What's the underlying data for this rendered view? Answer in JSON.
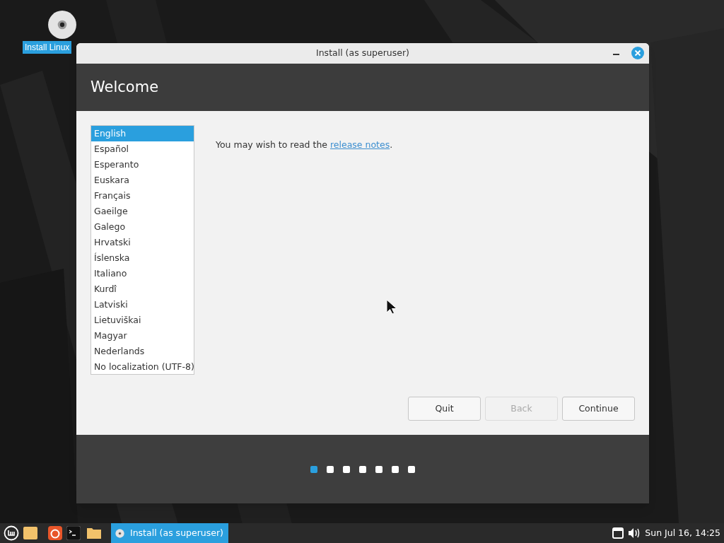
{
  "desktop": {
    "icons": [
      {
        "label": "Install Linux",
        "selected": true
      }
    ]
  },
  "window": {
    "title": "Install (as superuser)",
    "header": "Welcome",
    "languages": [
      {
        "label": "English",
        "selected": true
      },
      {
        "label": "Español",
        "selected": false
      },
      {
        "label": "Esperanto",
        "selected": false
      },
      {
        "label": "Euskara",
        "selected": false
      },
      {
        "label": "Français",
        "selected": false
      },
      {
        "label": "Gaeilge",
        "selected": false
      },
      {
        "label": "Galego",
        "selected": false
      },
      {
        "label": "Hrvatski",
        "selected": false
      },
      {
        "label": "Íslenska",
        "selected": false
      },
      {
        "label": "Italiano",
        "selected": false
      },
      {
        "label": "Kurdî",
        "selected": false
      },
      {
        "label": "Latviski",
        "selected": false
      },
      {
        "label": "Lietuviškai",
        "selected": false
      },
      {
        "label": "Magyar",
        "selected": false
      },
      {
        "label": "Nederlands",
        "selected": false
      },
      {
        "label": "No localization (UTF-8)",
        "selected": false
      }
    ],
    "message": {
      "before": "You may wish to read the ",
      "link": "release notes",
      "after": "."
    },
    "buttons": [
      {
        "label": "Quit",
        "disabled": false
      },
      {
        "label": "Back",
        "disabled": true
      },
      {
        "label": "Continue",
        "disabled": false
      }
    ],
    "steps": [
      {
        "selected": true
      },
      {
        "selected": false
      },
      {
        "selected": false
      },
      {
        "selected": false
      },
      {
        "selected": false
      },
      {
        "selected": false
      },
      {
        "selected": false
      }
    ]
  },
  "taskbar": {
    "tasks": [
      {
        "label": "Install (as superuser)",
        "selected": true
      }
    ],
    "clock": "Sun Jul 16, 14:25"
  }
}
